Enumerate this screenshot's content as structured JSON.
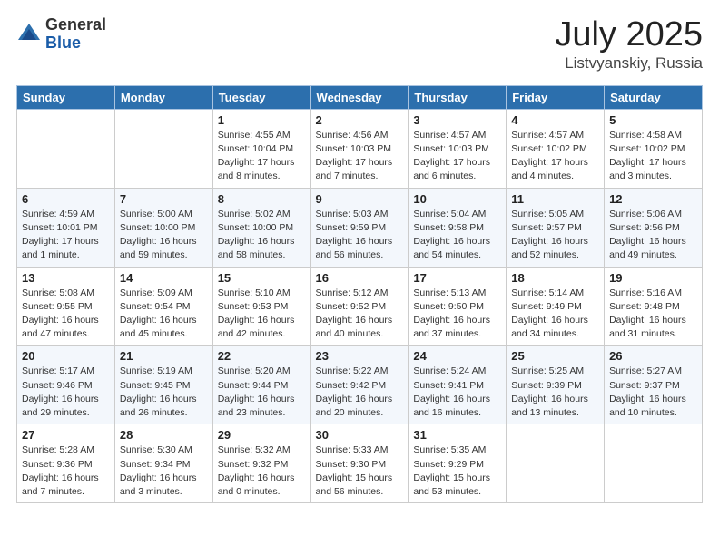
{
  "logo": {
    "general": "General",
    "blue": "Blue"
  },
  "title": "July 2025",
  "subtitle": "Listvyanskiy, Russia",
  "header_days": [
    "Sunday",
    "Monday",
    "Tuesday",
    "Wednesday",
    "Thursday",
    "Friday",
    "Saturday"
  ],
  "weeks": [
    [
      {
        "day": "",
        "sunrise": "",
        "sunset": "",
        "daylight": ""
      },
      {
        "day": "",
        "sunrise": "",
        "sunset": "",
        "daylight": ""
      },
      {
        "day": "1",
        "sunrise": "Sunrise: 4:55 AM",
        "sunset": "Sunset: 10:04 PM",
        "daylight": "Daylight: 17 hours and 8 minutes."
      },
      {
        "day": "2",
        "sunrise": "Sunrise: 4:56 AM",
        "sunset": "Sunset: 10:03 PM",
        "daylight": "Daylight: 17 hours and 7 minutes."
      },
      {
        "day": "3",
        "sunrise": "Sunrise: 4:57 AM",
        "sunset": "Sunset: 10:03 PM",
        "daylight": "Daylight: 17 hours and 6 minutes."
      },
      {
        "day": "4",
        "sunrise": "Sunrise: 4:57 AM",
        "sunset": "Sunset: 10:02 PM",
        "daylight": "Daylight: 17 hours and 4 minutes."
      },
      {
        "day": "5",
        "sunrise": "Sunrise: 4:58 AM",
        "sunset": "Sunset: 10:02 PM",
        "daylight": "Daylight: 17 hours and 3 minutes."
      }
    ],
    [
      {
        "day": "6",
        "sunrise": "Sunrise: 4:59 AM",
        "sunset": "Sunset: 10:01 PM",
        "daylight": "Daylight: 17 hours and 1 minute."
      },
      {
        "day": "7",
        "sunrise": "Sunrise: 5:00 AM",
        "sunset": "Sunset: 10:00 PM",
        "daylight": "Daylight: 16 hours and 59 minutes."
      },
      {
        "day": "8",
        "sunrise": "Sunrise: 5:02 AM",
        "sunset": "Sunset: 10:00 PM",
        "daylight": "Daylight: 16 hours and 58 minutes."
      },
      {
        "day": "9",
        "sunrise": "Sunrise: 5:03 AM",
        "sunset": "Sunset: 9:59 PM",
        "daylight": "Daylight: 16 hours and 56 minutes."
      },
      {
        "day": "10",
        "sunrise": "Sunrise: 5:04 AM",
        "sunset": "Sunset: 9:58 PM",
        "daylight": "Daylight: 16 hours and 54 minutes."
      },
      {
        "day": "11",
        "sunrise": "Sunrise: 5:05 AM",
        "sunset": "Sunset: 9:57 PM",
        "daylight": "Daylight: 16 hours and 52 minutes."
      },
      {
        "day": "12",
        "sunrise": "Sunrise: 5:06 AM",
        "sunset": "Sunset: 9:56 PM",
        "daylight": "Daylight: 16 hours and 49 minutes."
      }
    ],
    [
      {
        "day": "13",
        "sunrise": "Sunrise: 5:08 AM",
        "sunset": "Sunset: 9:55 PM",
        "daylight": "Daylight: 16 hours and 47 minutes."
      },
      {
        "day": "14",
        "sunrise": "Sunrise: 5:09 AM",
        "sunset": "Sunset: 9:54 PM",
        "daylight": "Daylight: 16 hours and 45 minutes."
      },
      {
        "day": "15",
        "sunrise": "Sunrise: 5:10 AM",
        "sunset": "Sunset: 9:53 PM",
        "daylight": "Daylight: 16 hours and 42 minutes."
      },
      {
        "day": "16",
        "sunrise": "Sunrise: 5:12 AM",
        "sunset": "Sunset: 9:52 PM",
        "daylight": "Daylight: 16 hours and 40 minutes."
      },
      {
        "day": "17",
        "sunrise": "Sunrise: 5:13 AM",
        "sunset": "Sunset: 9:50 PM",
        "daylight": "Daylight: 16 hours and 37 minutes."
      },
      {
        "day": "18",
        "sunrise": "Sunrise: 5:14 AM",
        "sunset": "Sunset: 9:49 PM",
        "daylight": "Daylight: 16 hours and 34 minutes."
      },
      {
        "day": "19",
        "sunrise": "Sunrise: 5:16 AM",
        "sunset": "Sunset: 9:48 PM",
        "daylight": "Daylight: 16 hours and 31 minutes."
      }
    ],
    [
      {
        "day": "20",
        "sunrise": "Sunrise: 5:17 AM",
        "sunset": "Sunset: 9:46 PM",
        "daylight": "Daylight: 16 hours and 29 minutes."
      },
      {
        "day": "21",
        "sunrise": "Sunrise: 5:19 AM",
        "sunset": "Sunset: 9:45 PM",
        "daylight": "Daylight: 16 hours and 26 minutes."
      },
      {
        "day": "22",
        "sunrise": "Sunrise: 5:20 AM",
        "sunset": "Sunset: 9:44 PM",
        "daylight": "Daylight: 16 hours and 23 minutes."
      },
      {
        "day": "23",
        "sunrise": "Sunrise: 5:22 AM",
        "sunset": "Sunset: 9:42 PM",
        "daylight": "Daylight: 16 hours and 20 minutes."
      },
      {
        "day": "24",
        "sunrise": "Sunrise: 5:24 AM",
        "sunset": "Sunset: 9:41 PM",
        "daylight": "Daylight: 16 hours and 16 minutes."
      },
      {
        "day": "25",
        "sunrise": "Sunrise: 5:25 AM",
        "sunset": "Sunset: 9:39 PM",
        "daylight": "Daylight: 16 hours and 13 minutes."
      },
      {
        "day": "26",
        "sunrise": "Sunrise: 5:27 AM",
        "sunset": "Sunset: 9:37 PM",
        "daylight": "Daylight: 16 hours and 10 minutes."
      }
    ],
    [
      {
        "day": "27",
        "sunrise": "Sunrise: 5:28 AM",
        "sunset": "Sunset: 9:36 PM",
        "daylight": "Daylight: 16 hours and 7 minutes."
      },
      {
        "day": "28",
        "sunrise": "Sunrise: 5:30 AM",
        "sunset": "Sunset: 9:34 PM",
        "daylight": "Daylight: 16 hours and 3 minutes."
      },
      {
        "day": "29",
        "sunrise": "Sunrise: 5:32 AM",
        "sunset": "Sunset: 9:32 PM",
        "daylight": "Daylight: 16 hours and 0 minutes."
      },
      {
        "day": "30",
        "sunrise": "Sunrise: 5:33 AM",
        "sunset": "Sunset: 9:30 PM",
        "daylight": "Daylight: 15 hours and 56 minutes."
      },
      {
        "day": "31",
        "sunrise": "Sunrise: 5:35 AM",
        "sunset": "Sunset: 9:29 PM",
        "daylight": "Daylight: 15 hours and 53 minutes."
      },
      {
        "day": "",
        "sunrise": "",
        "sunset": "",
        "daylight": ""
      },
      {
        "day": "",
        "sunrise": "",
        "sunset": "",
        "daylight": ""
      }
    ]
  ]
}
